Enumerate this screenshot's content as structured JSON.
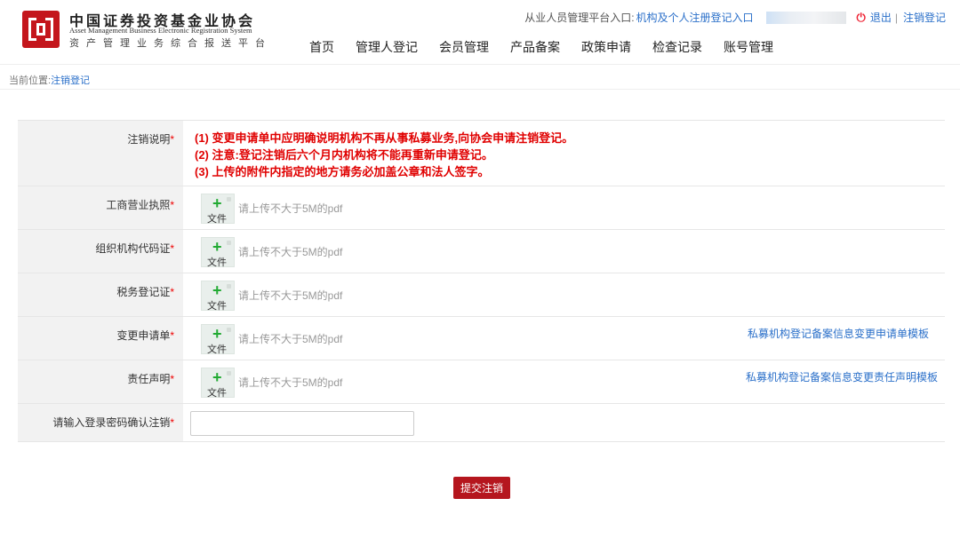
{
  "header": {
    "org_name_cn": "中国证券投资基金业协会",
    "org_name_en": "Asset Management Business Electronic Registration System",
    "system_name": "资产管理业务综合报送平台",
    "nav": [
      "首页",
      "管理人登记",
      "会员管理",
      "产品备案",
      "政策申请",
      "检查记录",
      "账号管理"
    ],
    "top_links": {
      "practitioner_label": "从业人员管理平台入口:",
      "practitioner_link": "机构及个人注册登记入口",
      "logout": "退出",
      "separator": "|",
      "cancel_reg": "注销登记"
    }
  },
  "breadcrumb": {
    "label": "当前位置:",
    "current": "注销登记"
  },
  "form": {
    "notes_label": "注销说明",
    "notes": [
      "(1)  变更申请单中应明确说明机构不再从事私募业务,向协会申请注销登记。",
      "(2)  注意:登记注销后六个月内机构将不能再重新申请登记。",
      "(3) 上传的附件内指定的地方请务必加盖公章和法人签字。"
    ],
    "required_mark": "*",
    "upload_button_text": "文件",
    "upload_hint": "请上传不大于5M的pdf",
    "uploads": [
      {
        "label": "工商营业执照",
        "template": ""
      },
      {
        "label": "组织机构代码证",
        "template": ""
      },
      {
        "label": "税务登记证",
        "template": ""
      },
      {
        "label": "变更申请单",
        "template": "私募机构登记备案信息变更申请单模板"
      },
      {
        "label": "责任声明",
        "template": "私募机构登记备案信息变更责任声明模板"
      }
    ],
    "password_label": "请输入登录密码确认注销",
    "password_value": ""
  },
  "submit_label": "提交注销",
  "colors": {
    "brand_red": "#c4161c",
    "link_blue": "#2a6fc9",
    "note_red": "#e00000",
    "plus_green": "#22aa33"
  }
}
